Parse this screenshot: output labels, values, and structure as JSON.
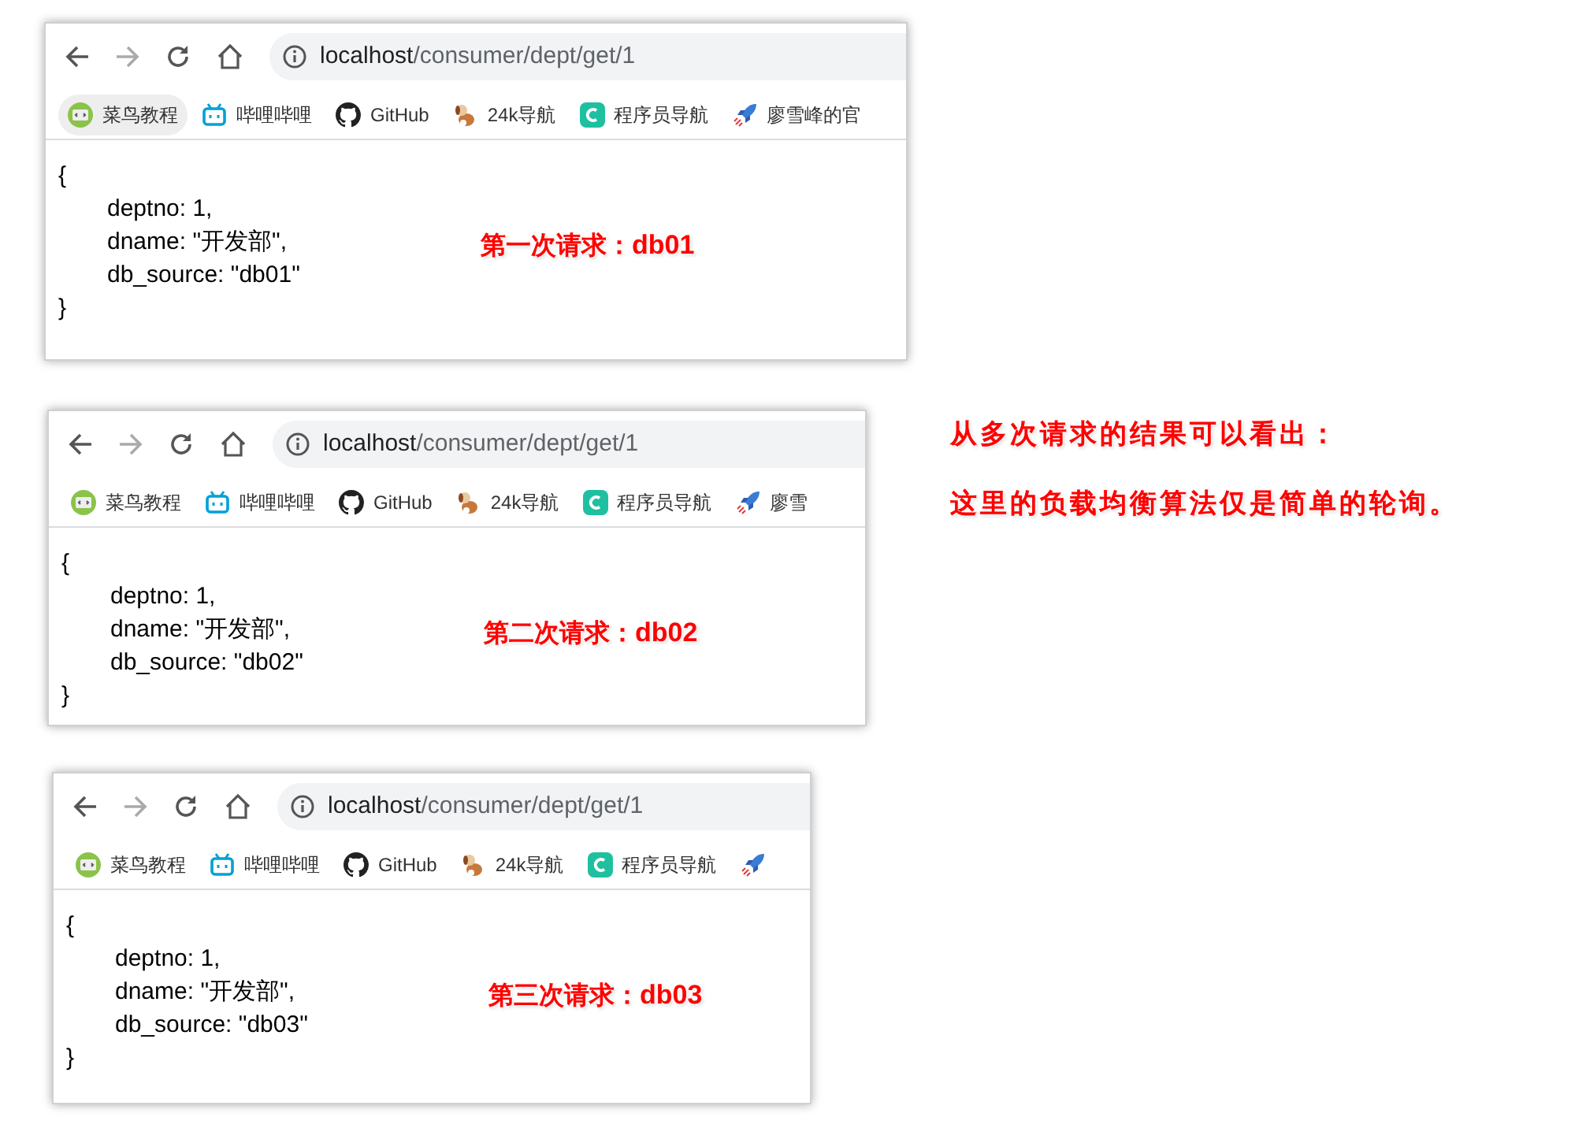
{
  "windows": [
    {
      "url": {
        "host": "localhost",
        "path": "/consumer/dept/get/1"
      },
      "bookmarks": [
        {
          "kind": "runoob",
          "label": "菜鸟教程",
          "hovered": true
        },
        {
          "kind": "tv",
          "label": "哔哩哔哩",
          "hovered": false
        },
        {
          "kind": "github",
          "label": "GitHub",
          "hovered": false
        },
        {
          "kind": "dog",
          "label": "24k导航",
          "hovered": false
        },
        {
          "kind": "c",
          "label": "程序员导航",
          "hovered": false
        },
        {
          "kind": "rocket",
          "label": "廖雪峰的官",
          "hovered": false
        }
      ],
      "json": {
        "open": "{",
        "fields": [
          "deptno: 1,",
          "dname: \"开发部\",",
          "db_source: \"db01\""
        ],
        "close": "}"
      },
      "note": {
        "label": "第一次请求：",
        "value": "db01"
      }
    },
    {
      "url": {
        "host": "localhost",
        "path": "/consumer/dept/get/1"
      },
      "bookmarks": [
        {
          "kind": "runoob",
          "label": "菜鸟教程",
          "hovered": false
        },
        {
          "kind": "tv",
          "label": "哔哩哔哩",
          "hovered": false
        },
        {
          "kind": "github",
          "label": "GitHub",
          "hovered": false
        },
        {
          "kind": "dog",
          "label": "24k导航",
          "hovered": false
        },
        {
          "kind": "c",
          "label": "程序员导航",
          "hovered": false
        },
        {
          "kind": "rocket",
          "label": "廖雪",
          "hovered": false
        }
      ],
      "json": {
        "open": "{",
        "fields": [
          "deptno: 1,",
          "dname: \"开发部\",",
          "db_source: \"db02\""
        ],
        "close": "}"
      },
      "note": {
        "label": "第二次请求：",
        "value": "db02"
      }
    },
    {
      "url": {
        "host": "localhost",
        "path": "/consumer/dept/get/1"
      },
      "bookmarks": [
        {
          "kind": "runoob",
          "label": "菜鸟教程",
          "hovered": false
        },
        {
          "kind": "tv",
          "label": "哔哩哔哩",
          "hovered": false
        },
        {
          "kind": "github",
          "label": "GitHub",
          "hovered": false
        },
        {
          "kind": "dog",
          "label": "24k导航",
          "hovered": false
        },
        {
          "kind": "c",
          "label": "程序员导航",
          "hovered": false
        },
        {
          "kind": "rocket",
          "hovered": false
        }
      ],
      "json": {
        "open": "{",
        "fields": [
          "deptno: 1,",
          "dname: \"开发部\",",
          "db_source: \"db03\""
        ],
        "close": "}"
      },
      "note": {
        "label": "第三次请求：",
        "value": "db03"
      }
    }
  ],
  "conclusion": [
    "从多次请求的结果可以看出：",
    "这里的负载均衡算法仅是简单的轮询。"
  ]
}
